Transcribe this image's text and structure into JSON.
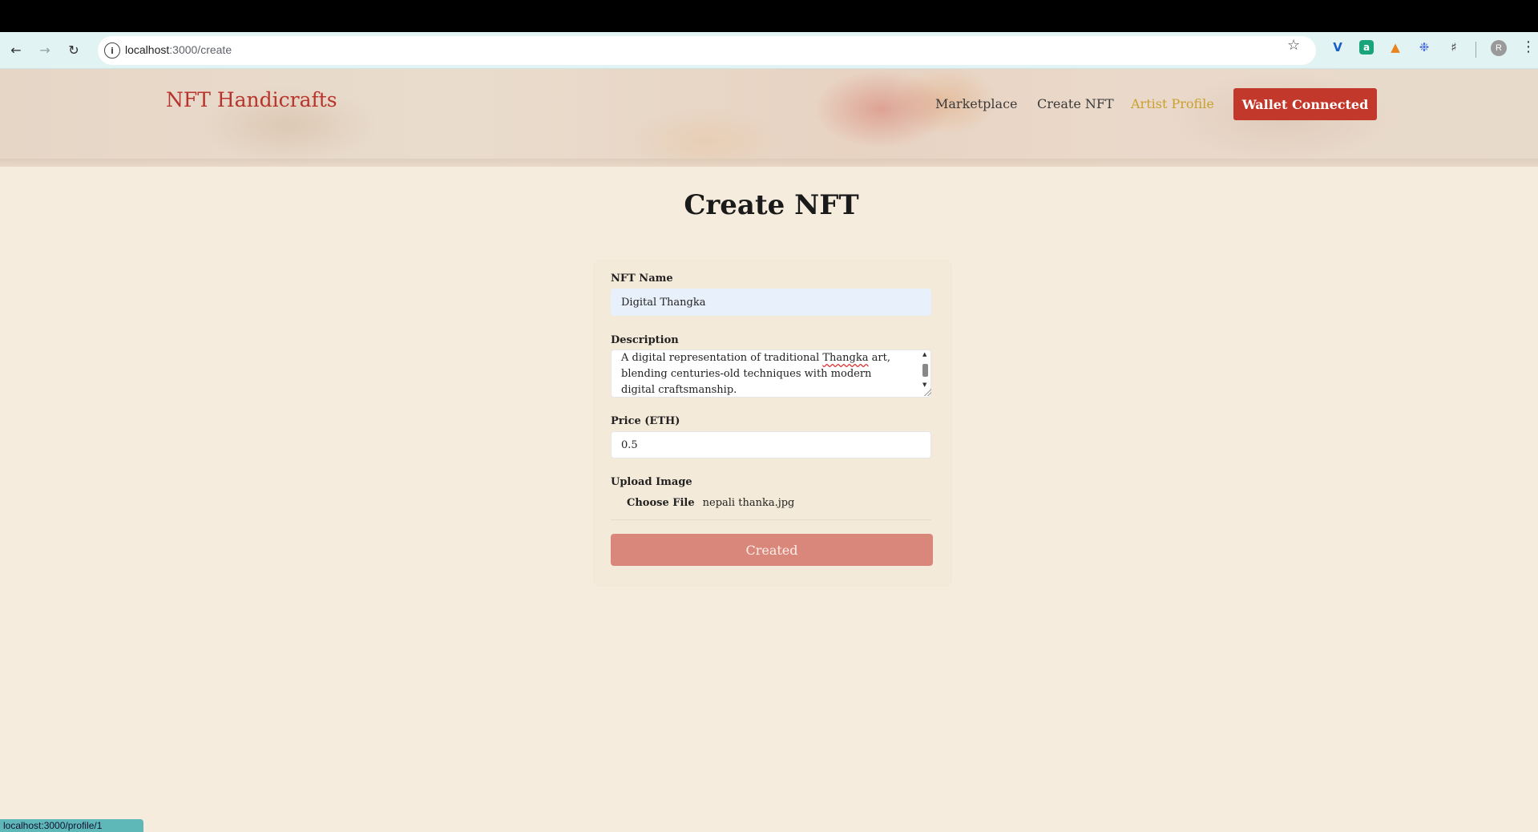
{
  "browser": {
    "url_host": "localhost",
    "url_path": ":3000/create",
    "status_url": "localhost:3000/profile/1",
    "profile_initial": "R"
  },
  "site": {
    "brand": "NFT Handicrafts",
    "nav": [
      {
        "label": "Marketplace"
      },
      {
        "label": "Create NFT"
      },
      {
        "label": "Artist Profile"
      }
    ],
    "wallet_label": "Wallet Connected"
  },
  "page": {
    "title": "Create NFT"
  },
  "form": {
    "name_label": "NFT Name",
    "name_value": "Digital Thangka",
    "description_label": "Description",
    "description_line1a": "A digital representation of traditional ",
    "description_spell": "Thangka",
    "description_line1b": " art,",
    "description_line2": "blending centuries-old techniques with modern",
    "description_line3": "digital craftsmanship.",
    "price_label": "Price (ETH)",
    "price_value": "0.5",
    "upload_label": "Upload Image",
    "choose_file": "Choose File",
    "file_name": "nepali thanka.jpg",
    "submit_label": "Created"
  },
  "colors": {
    "brand": "#b8332c",
    "active_nav": "#c9a02f",
    "wallet_button": "#c2392c",
    "submit_button": "#d9877b",
    "page_bg": "#f5ecdd"
  }
}
